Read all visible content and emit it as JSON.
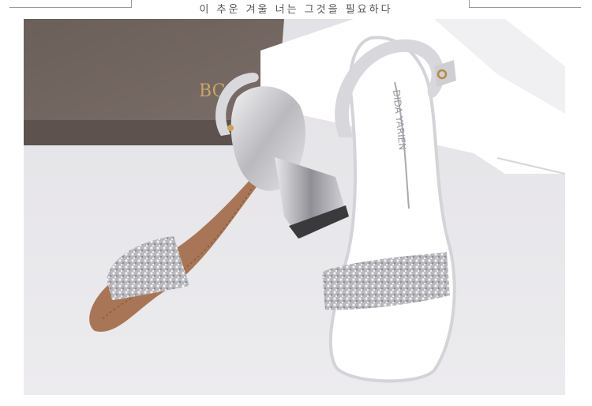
{
  "header": {
    "caption": "이 추운 겨울 너는 그것을 필요하다"
  },
  "photo": {
    "box_brand_text": "BC",
    "insole_brand_text": "DIDA YARIEN"
  },
  "colors": {
    "box_brown": "#6e625c",
    "floor": "#e8e7ea",
    "silver": "#c9c9cc",
    "sole": "#a07054"
  }
}
